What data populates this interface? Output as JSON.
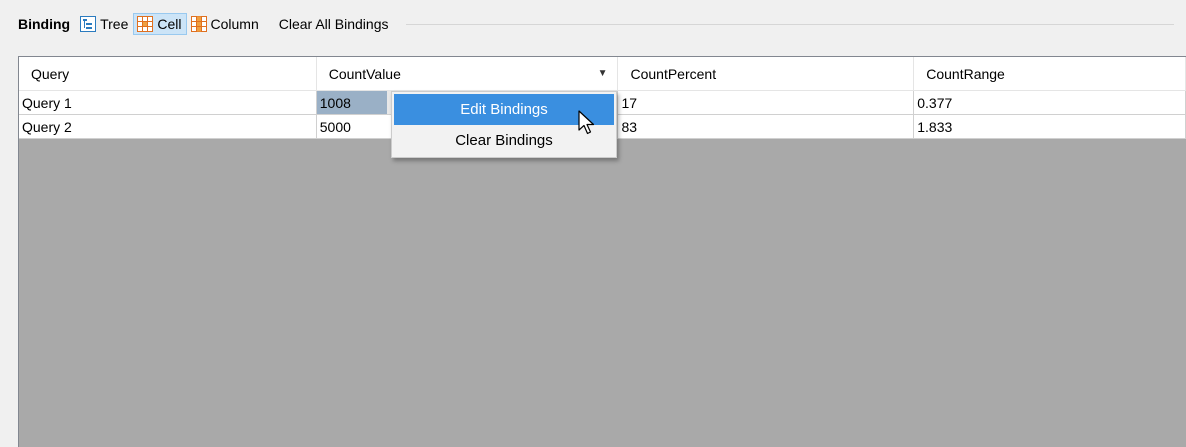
{
  "toolbar": {
    "label": "Binding",
    "tree": "Tree",
    "cell": "Cell",
    "column": "Column",
    "clear_all": "Clear All Bindings",
    "active": "Cell"
  },
  "grid": {
    "headers": [
      "Query",
      "CountValue",
      "CountPercent",
      "CountRange"
    ],
    "rows": [
      [
        "Query 1",
        "1008",
        "17",
        "0.377"
      ],
      [
        "Query 2",
        "5000",
        "83",
        "1.833"
      ]
    ],
    "selected_cell": "Query 1 / CountValue"
  },
  "context_menu": {
    "items": [
      "Edit Bindings",
      "Clear Bindings"
    ],
    "highlighted": "Edit Bindings"
  },
  "colors": {
    "accent": "#3a8fe0",
    "grid_background": "#a9a9a9",
    "active_button": "#cce4f7",
    "selected_cell": "#9ab0c6"
  }
}
